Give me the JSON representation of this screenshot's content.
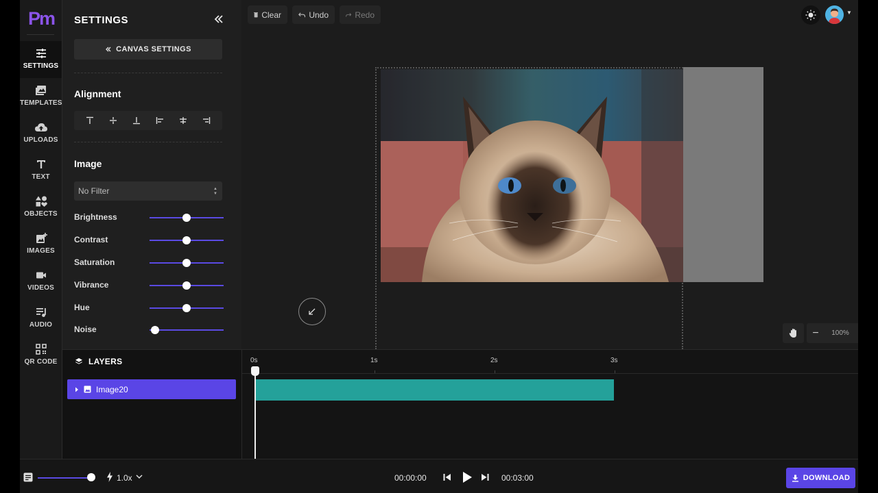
{
  "app": {
    "logo_text": "Pm",
    "brand_color": "#8b54ea",
    "accent_color": "#5a45e6"
  },
  "nav": {
    "items": [
      {
        "label": "SETTINGS",
        "icon": "sliders-icon",
        "active": true
      },
      {
        "label": "TEMPLATES",
        "icon": "photo-library-icon"
      },
      {
        "label": "UPLOADS",
        "icon": "cloud-upload-icon"
      },
      {
        "label": "TEXT",
        "icon": "text-icon"
      },
      {
        "label": "OBJECTS",
        "icon": "shapes-icon"
      },
      {
        "label": "IMAGES",
        "icon": "add-image-icon"
      },
      {
        "label": "VIDEOS",
        "icon": "video-icon"
      },
      {
        "label": "AUDIO",
        "icon": "music-icon"
      },
      {
        "label": "QR CODE",
        "icon": "qr-code-icon"
      }
    ]
  },
  "panel": {
    "title": "SETTINGS",
    "canvas_settings_label": "CANVAS SETTINGS",
    "alignment_title": "Alignment",
    "image_title": "Image",
    "filter_value": "No Filter",
    "sliders": [
      {
        "label": "Brightness",
        "value": 0.5
      },
      {
        "label": "Contrast",
        "value": 0.5
      },
      {
        "label": "Saturation",
        "value": 0.5
      },
      {
        "label": "Vibrance",
        "value": 0.5
      },
      {
        "label": "Hue",
        "value": 0.5
      },
      {
        "label": "Noise",
        "value": 0.0
      }
    ]
  },
  "toolbar": {
    "clear_label": "Clear",
    "undo_label": "Undo",
    "redo_label": "Redo"
  },
  "canvas": {
    "zoom_label": "100%"
  },
  "layers": {
    "title": "LAYERS",
    "items": [
      {
        "name": "Image20"
      }
    ]
  },
  "timeline": {
    "ticks": [
      "0s",
      "1s",
      "2s",
      "3s"
    ],
    "clip_color": "#24a19a"
  },
  "bottom": {
    "speed_label": "1.0x",
    "time_current": "00:00:00",
    "time_total": "00:03:00",
    "download_label": "DOWNLOAD"
  }
}
